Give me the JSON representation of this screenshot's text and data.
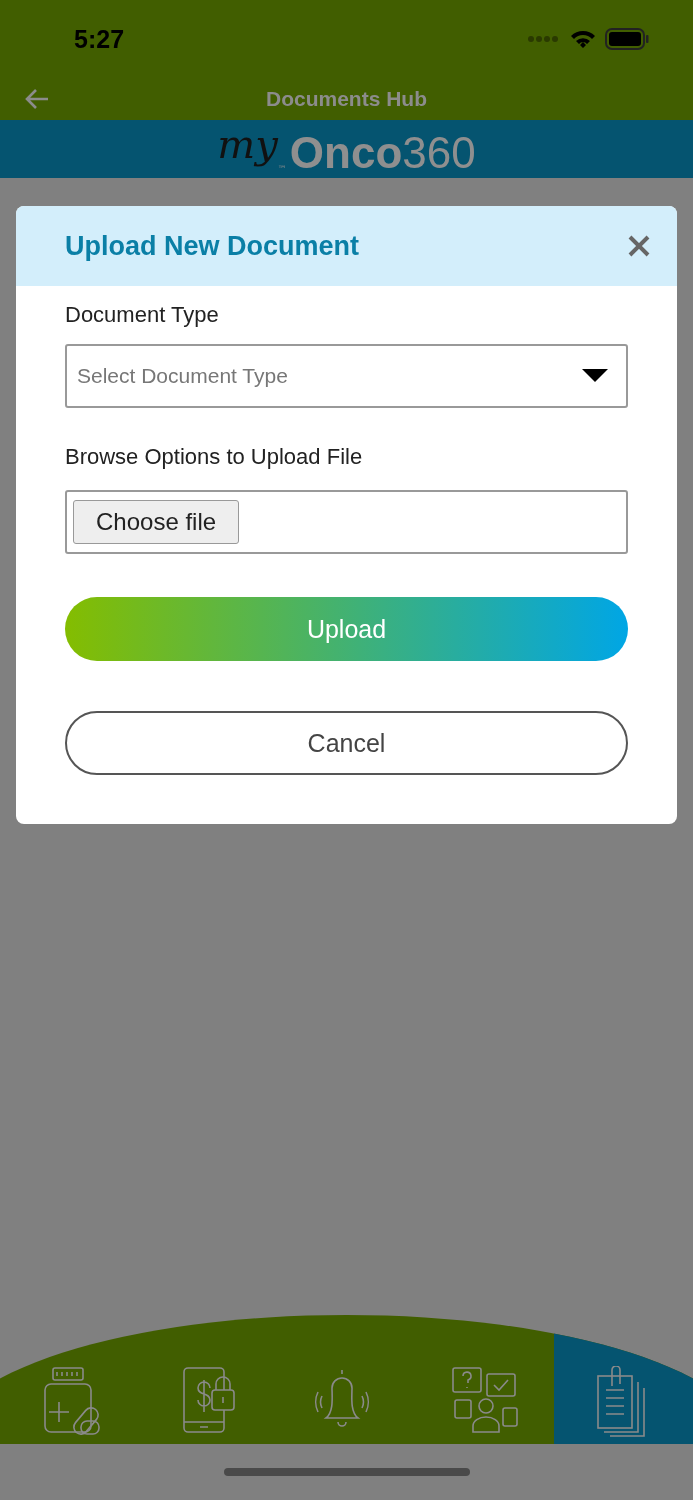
{
  "status_bar": {
    "time": "5:27"
  },
  "header": {
    "title": "Documents Hub"
  },
  "logo": {
    "script": "my",
    "mark": "™",
    "name": "**Onco**360"
  },
  "dialog": {
    "title": "Upload New Document",
    "document_type": {
      "label": "Document Type",
      "placeholder": "Select Document Type"
    },
    "file": {
      "label": "Browse Options to Upload File",
      "button": "Choose file"
    },
    "buttons": [
      {
        "label": "Upload",
        "kind": "primary"
      },
      {
        "label": "Cancel",
        "kind": "secondary"
      }
    ]
  },
  "nav": [
    {
      "kind": "medicine",
      "selected": false
    },
    {
      "kind": "payment",
      "selected": false
    },
    {
      "kind": "bell",
      "selected": false
    },
    {
      "kind": "support",
      "selected": false
    },
    {
      "kind": "documents",
      "selected": true
    }
  ]
}
